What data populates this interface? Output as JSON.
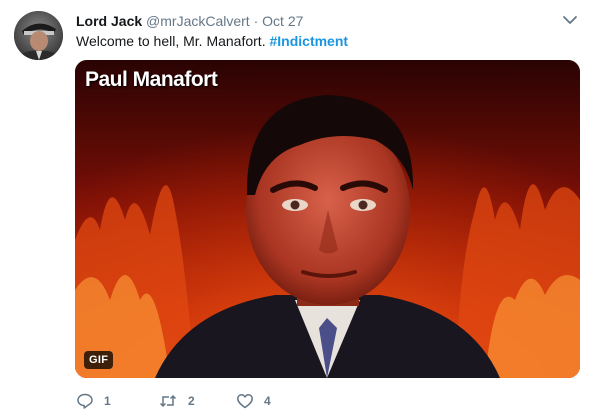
{
  "tweet": {
    "author_name": "Lord Jack",
    "handle": "@mrJackCalvert",
    "separator": "·",
    "time": "Oct 27",
    "text_plain": "Welcome to hell, Mr. Manafort. ",
    "hashtag": "#Indictment",
    "avatar_icon": "user-avatar"
  },
  "media": {
    "title": "Paul Manafort",
    "badge": "GIF"
  },
  "actions": {
    "reply": {
      "icon": "reply-icon",
      "count": "1"
    },
    "retweet": {
      "icon": "retweet-icon",
      "count": "2"
    },
    "like": {
      "icon": "heart-icon",
      "count": "4"
    }
  },
  "colors": {
    "link": "#1b95e0",
    "muted": "#657786",
    "text": "#14171a"
  }
}
